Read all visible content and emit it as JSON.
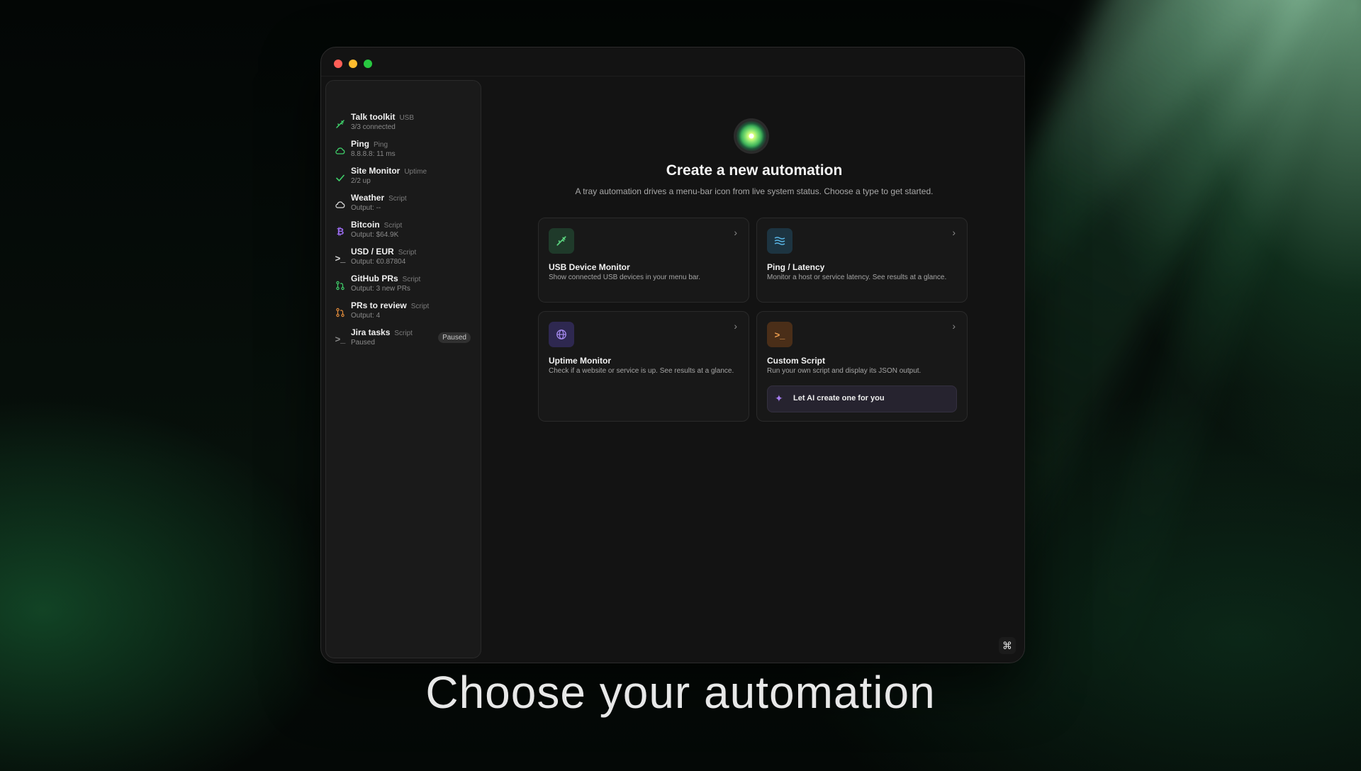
{
  "colors": {
    "accent_green": "#3fcf6a",
    "window_bg": "#131313",
    "sidebar_bg": "#1a1a1a"
  },
  "sidebar": {
    "items": [
      {
        "title": "Talk toolkit",
        "type": "USB",
        "sub": "3/3 connected",
        "icon": "usb-icon",
        "icon_color": "#3fcf6a"
      },
      {
        "title": "Ping",
        "type": "Ping",
        "sub": "8.8.8.8: 11 ms",
        "icon": "cloud-icon",
        "icon_color": "#3fcf6a"
      },
      {
        "title": "Site Monitor",
        "type": "Uptime",
        "sub": "2/2 up",
        "icon": "check-icon",
        "icon_color": "#3fcf6a"
      },
      {
        "title": "Weather",
        "type": "Script",
        "sub": "Output: --",
        "icon": "cloud-icon",
        "icon_color": "#d8d8d8"
      },
      {
        "title": "Bitcoin",
        "type": "Script",
        "sub": "Output: $64.9K",
        "icon": "bitcoin-icon",
        "icon_color": "#9b6cf0"
      },
      {
        "title": "USD / EUR",
        "type": "Script",
        "sub": "Output: €0.87804",
        "icon": "terminal-icon",
        "icon_color": "#d8d8d8"
      },
      {
        "title": "GitHub PRs",
        "type": "Script",
        "sub": "Output: 3 new PRs",
        "icon": "git-pr-icon",
        "icon_color": "#3fcf6a"
      },
      {
        "title": "PRs to review",
        "type": "Script",
        "sub": "Output: 4",
        "icon": "git-pr-icon",
        "icon_color": "#e08a3a"
      },
      {
        "title": "Jira tasks",
        "type": "Script",
        "sub": "Paused",
        "icon": "terminal-icon",
        "icon_color": "#8a8a8a",
        "badge": "Paused"
      }
    ]
  },
  "main": {
    "title": "Create a new automation",
    "subtitle": "A tray automation drives a menu-bar icon from live system status. Choose a type to get started.",
    "cards": [
      {
        "title": "USB Device Monitor",
        "desc": "Show connected USB devices in your menu bar.",
        "icon": "usb-icon"
      },
      {
        "title": "Ping / Latency",
        "desc": "Monitor a host or service latency. See results at a glance.",
        "icon": "waves-icon"
      },
      {
        "title": "Uptime Monitor",
        "desc": "Check if a website or service is up. See results at a glance.",
        "icon": "globe-icon"
      },
      {
        "title": "Custom Script",
        "desc": "Run your own script and display its JSON output.",
        "icon": "terminal-icon"
      }
    ],
    "ai_button_label": "Let AI create one for you"
  },
  "caption": "Choose your automation"
}
